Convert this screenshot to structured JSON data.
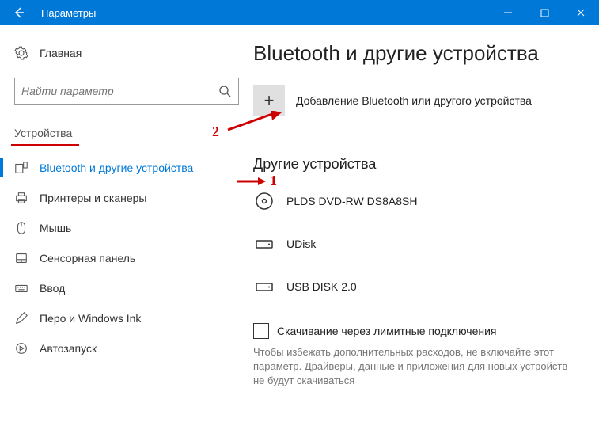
{
  "titlebar": {
    "title": "Параметры"
  },
  "sidebar": {
    "home_label": "Главная",
    "search_placeholder": "Найти параметр",
    "section_label": "Устройства",
    "items": [
      {
        "label": "Bluetooth и другие устройства"
      },
      {
        "label": "Принтеры и сканеры"
      },
      {
        "label": "Мышь"
      },
      {
        "label": "Сенсорная панель"
      },
      {
        "label": "Ввод"
      },
      {
        "label": "Перо и Windows Ink"
      },
      {
        "label": "Автозапуск"
      }
    ]
  },
  "main": {
    "heading": "Bluetooth и другие устройства",
    "add_label": "Добавление Bluetooth или другого устройства",
    "other_heading": "Другие устройства",
    "devices": [
      {
        "label": "PLDS DVD-RW DS8A8SH"
      },
      {
        "label": "UDisk"
      },
      {
        "label": "USB DISK 2.0"
      }
    ],
    "metered_label": "Скачивание через лимитные подключения",
    "metered_desc": "Чтобы избежать дополнительных расходов, не включайте этот параметр. Драйверы, данные и приложения для новых устройств не будут скачиваться"
  },
  "annotations": {
    "a1": "1",
    "a2": "2"
  }
}
